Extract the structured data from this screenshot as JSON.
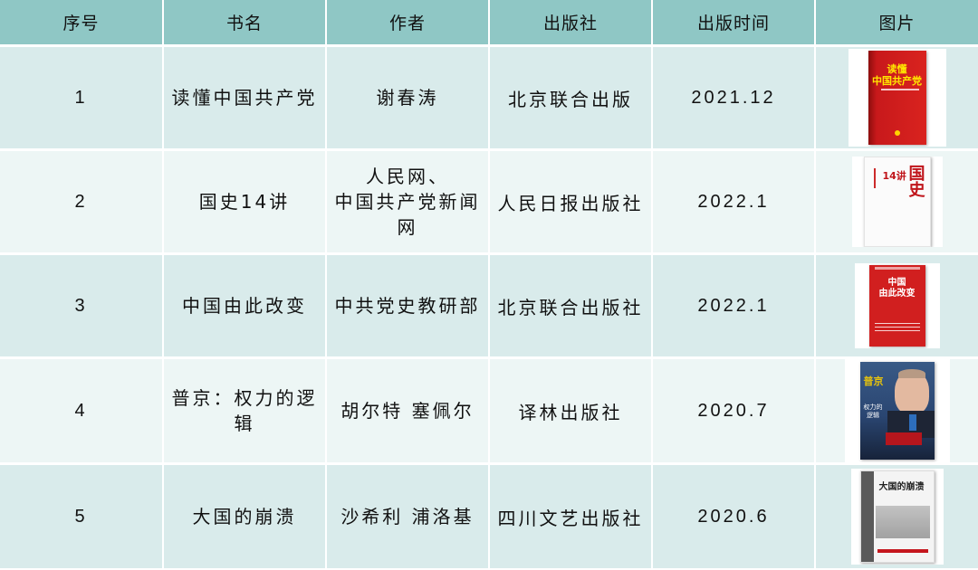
{
  "headers": {
    "index": "序号",
    "title": "书名",
    "author": "作者",
    "publisher": "出版社",
    "date": "出版时间",
    "image": "图片"
  },
  "rows": [
    {
      "index": "1",
      "title": "读懂中国共产党",
      "author": [
        "谢春涛"
      ],
      "publisher": "北京联合出版",
      "date": "2021.12",
      "cover": {
        "icon": "book-cover-red",
        "color": "#d9231f",
        "text": [
          "读懂",
          "中国共产党"
        ]
      }
    },
    {
      "index": "2",
      "title": "国史14讲",
      "author": [
        "人民网、",
        "中国共产党新闻网"
      ],
      "publisher": "人民日报出版社",
      "date": "2022.1",
      "cover": {
        "icon": "book-cover-white",
        "color": "#c0141a",
        "text": [
          "国史",
          "14讲"
        ]
      }
    },
    {
      "index": "3",
      "title": "中国由此改变",
      "author": [
        "中共党史教研部"
      ],
      "publisher": "北京联合出版社",
      "date": "2022.1",
      "cover": {
        "icon": "book-cover-red",
        "color": "#d11f1f",
        "text": [
          "中国",
          "由此改变"
        ]
      }
    },
    {
      "index": "4",
      "title": "普京：权力的逻辑",
      "author": [
        "胡尔特 塞佩尔"
      ],
      "publisher": "译林出版社",
      "date": "2020.7",
      "cover": {
        "icon": "book-cover-portrait",
        "color": "#2a4672",
        "text": [
          "普京",
          "权力的",
          "逻辑"
        ]
      }
    },
    {
      "index": "5",
      "title": "大国的崩溃",
      "author": [
        "沙希利 浦洛基"
      ],
      "publisher": "四川文艺出版社",
      "date": "2020.6",
      "cover": {
        "icon": "book-cover-grey",
        "color": "#5a5a5a",
        "text": [
          "大国的崩溃"
        ]
      }
    }
  ]
}
